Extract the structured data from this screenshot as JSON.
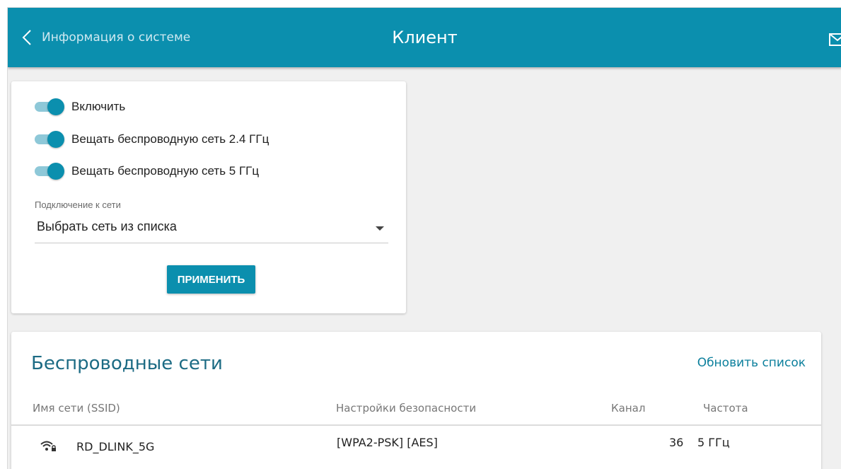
{
  "header": {
    "back_label": "Информация о системе",
    "title": "Клиент"
  },
  "settings": {
    "toggles": [
      {
        "label": "Включить",
        "on": true
      },
      {
        "label": "Вещать беспроводную сеть 2.4 ГГц",
        "on": true
      },
      {
        "label": "Вещать беспроводную сеть 5 ГГц",
        "on": true
      }
    ],
    "network_label": "Подключение к сети",
    "network_value": "Выбрать сеть из списка",
    "apply_label": "ПРИМЕНИТЬ"
  },
  "networks": {
    "title": "Беспроводные сети",
    "refresh_label": "Обновить список",
    "columns": {
      "ssid": "Имя сети (SSID)",
      "security": "Настройки безопасности",
      "channel": "Канал",
      "frequency": "Частота"
    },
    "rows": [
      {
        "icon": "wifi-lock-icon",
        "ssid": "RD_DLINK_5G",
        "security": "[WPA2-PSK] [AES]",
        "channel": "36",
        "frequency": "5 ГГц"
      }
    ]
  },
  "colors": {
    "accent": "#0b8fae",
    "toggle_track": "#8ec8d8",
    "title_text": "#1c6b84"
  }
}
